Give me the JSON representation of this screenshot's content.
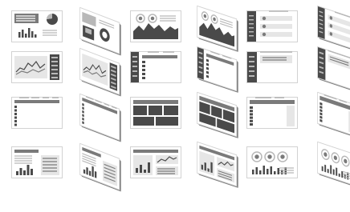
{
  "colors": {
    "dark": "#4a4a4a",
    "mid": "#7a7a7a",
    "light": "#b8b8b8",
    "pale": "#e6e6e6",
    "frame": "#d2d2d2",
    "white": "#ffffff"
  },
  "thumbnails": [
    {
      "variant": "dashboard-pie-bars",
      "view": "flat"
    },
    {
      "variant": "donut-tiles",
      "view": "iso-left"
    },
    {
      "variant": "gauges-area",
      "view": "flat"
    },
    {
      "variant": "gauges-area",
      "view": "iso-right"
    },
    {
      "variant": "sidebar-toggles",
      "view": "flat"
    },
    {
      "variant": "sidebar-toggles",
      "view": "iso-right"
    },
    {
      "variant": "line-chart-list",
      "view": "flat"
    },
    {
      "variant": "line-chart-list",
      "view": "iso-left"
    },
    {
      "variant": "table-sidebar",
      "view": "flat"
    },
    {
      "variant": "table-sidebar",
      "view": "iso-right"
    },
    {
      "variant": "panel-list",
      "view": "flat"
    },
    {
      "variant": "panel-list",
      "view": "iso-right"
    },
    {
      "variant": "table-rows",
      "view": "flat"
    },
    {
      "variant": "table-rows",
      "view": "iso-left"
    },
    {
      "variant": "blocks-grid",
      "view": "flat"
    },
    {
      "variant": "blocks-grid",
      "view": "iso-right"
    },
    {
      "variant": "table-list",
      "view": "flat"
    },
    {
      "variant": "table-list",
      "view": "iso-right"
    },
    {
      "variant": "text-bars",
      "view": "flat"
    },
    {
      "variant": "text-bars",
      "view": "iso-left"
    },
    {
      "variant": "bars-tiles",
      "view": "flat"
    },
    {
      "variant": "bars-tiles",
      "view": "iso-right"
    },
    {
      "variant": "radials-bars",
      "view": "flat"
    },
    {
      "variant": "radials-bars",
      "view": "iso-right"
    }
  ]
}
